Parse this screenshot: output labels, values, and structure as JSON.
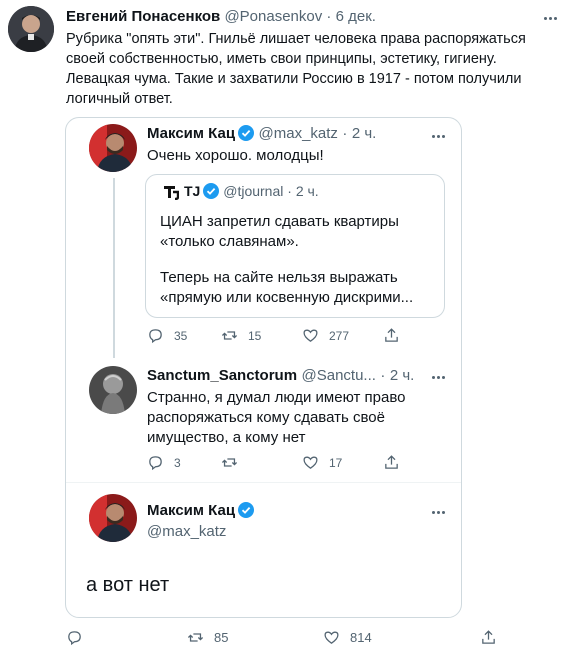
{
  "outer": {
    "author_name": "Евгений Понасенков",
    "author_handle": "@Ponasenkov",
    "separator": "·",
    "time": "6 дек.",
    "text": "Рубрика \"опять эти\". Гнильё лишает человека права распоряжаться своей собственностью, иметь свои принципы, эстетику, гигиену. Левацкая чума. Такие и захватили Россию в 1917 - потом получили логичный ответ.",
    "actions": {
      "reply": "",
      "retweet": "85",
      "like": "814"
    }
  },
  "embedded": {
    "tweet1": {
      "author_name": "Максим Кац",
      "author_handle": "@max_katz",
      "separator": "·",
      "time": "2 ч.",
      "text": "Очень хорошо. молодцы!",
      "quote": {
        "logo_text": "TJ",
        "author_name": "TJ",
        "author_handle": "@tjournal",
        "separator": "·",
        "time": "2 ч.",
        "line1": "ЦИАН запретил сдавать квартиры «только славянам».",
        "line2": "Теперь на сайте нельзя выражать «прямую или косвенную дискрими..."
      },
      "actions": {
        "reply": "35",
        "retweet": "15",
        "like": "277"
      }
    },
    "tweet2": {
      "author_name": "Sanctum_Sanctorum",
      "author_handle": "@Sanctu...",
      "separator": "·",
      "time": "2 ч.",
      "text": "Странно, я думал люди имеют право распоряжаться кому сдавать своё имущество, а кому нет",
      "actions": {
        "reply": "3",
        "retweet": "",
        "like": "17"
      }
    },
    "tweet3": {
      "author_name": "Максим Кац",
      "author_handle": "@max_katz",
      "text": "а вот нет"
    }
  },
  "colors": {
    "verified": "#1d9bf0",
    "border": "#cfd9de",
    "muted": "#536471",
    "text": "#0f1419"
  }
}
